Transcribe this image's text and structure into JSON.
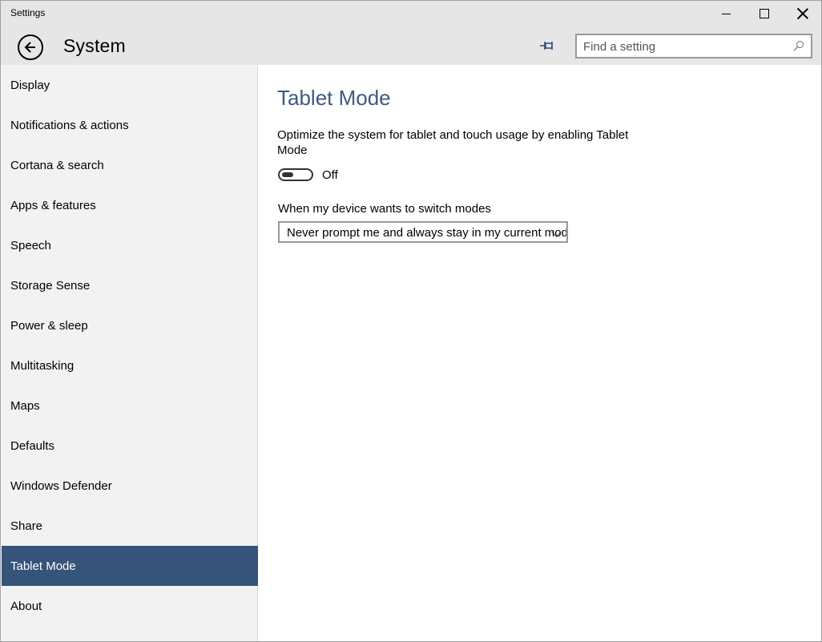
{
  "window": {
    "title": "Settings"
  },
  "header": {
    "title": "System",
    "search": {
      "placeholder": "Find a setting",
      "value": ""
    }
  },
  "sidebar": {
    "items": [
      {
        "label": "Display"
      },
      {
        "label": "Notifications & actions"
      },
      {
        "label": "Cortana & search"
      },
      {
        "label": "Apps & features"
      },
      {
        "label": "Speech"
      },
      {
        "label": "Storage Sense"
      },
      {
        "label": "Power & sleep"
      },
      {
        "label": "Multitasking"
      },
      {
        "label": "Maps"
      },
      {
        "label": "Defaults"
      },
      {
        "label": "Windows Defender"
      },
      {
        "label": "Share"
      },
      {
        "label": "Tablet Mode",
        "selected": true
      },
      {
        "label": "About"
      }
    ],
    "selected_color": "#365379"
  },
  "main": {
    "title": "Tablet Mode",
    "title_color": "#3d5a80",
    "description": "Optimize the system for tablet and touch usage by enabling Tablet Mode",
    "toggle": {
      "on": false,
      "state_label": "Off"
    },
    "switch_modes": {
      "label": "When my device wants to switch modes",
      "selected": "Never prompt me and always stay in my current mode"
    }
  },
  "icons": {
    "back": "back-arrow-icon",
    "pin": "pin-icon",
    "search": "search-icon",
    "minimize": "minimize-icon",
    "maximize": "maximize-icon",
    "close": "close-icon"
  }
}
